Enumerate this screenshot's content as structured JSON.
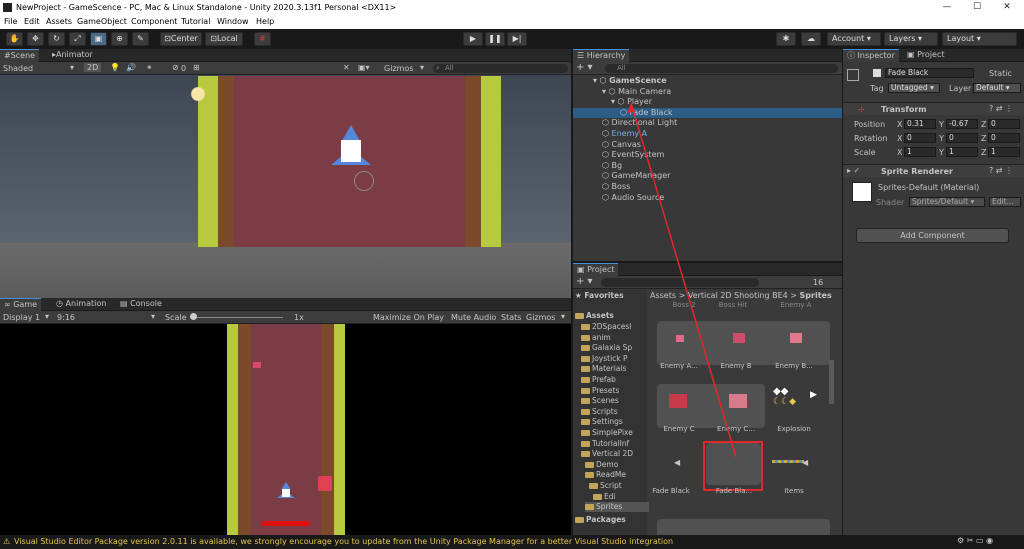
{
  "window": {
    "title": "NewProject - GameScence - PC, Mac & Linux Standalone - Unity 2020.3.13f1 Personal <DX11>"
  },
  "menu": [
    "File",
    "Edit",
    "Assets",
    "GameObject",
    "Component",
    "Tutorial",
    "Window",
    "Help"
  ],
  "toolbar": {
    "center": "Center",
    "local": "Local",
    "account": "Account",
    "layers": "Layers",
    "layout": "Layout"
  },
  "scene": {
    "tab_scene": "Scene",
    "tab_animator": "Animator",
    "shading": "Shaded",
    "mode2d": "2D",
    "gizmos": "Gizmos",
    "search": "All",
    "layer_count": "0"
  },
  "game": {
    "tab_game": "Game",
    "tab_animation": "Animation",
    "tab_console": "Console",
    "display": "Display 1",
    "aspect": "9:16",
    "scale_label": "Scale",
    "scale_value": "1x",
    "maximize": "Maximize On Play",
    "mute": "Mute Audio",
    "stats": "Stats",
    "gizmos": "Gizmos"
  },
  "hierarchy": {
    "tab": "Hierarchy",
    "search": "All",
    "rows": [
      {
        "label": "GameScence",
        "indent": 0,
        "bold": true
      },
      {
        "label": "Main Camera",
        "indent": 1
      },
      {
        "label": "Player",
        "indent": 2
      },
      {
        "label": "Fade Black",
        "indent": 3,
        "selected": true
      },
      {
        "label": "Directional Light",
        "indent": 1
      },
      {
        "label": "Enemy A",
        "indent": 1,
        "blue": true
      },
      {
        "label": "Canvas",
        "indent": 1
      },
      {
        "label": "EventSystem",
        "indent": 1
      },
      {
        "label": "Bg",
        "indent": 1
      },
      {
        "label": "GameManager",
        "indent": 1
      },
      {
        "label": "Boss",
        "indent": 1
      },
      {
        "label": "Audio Source",
        "indent": 1
      }
    ]
  },
  "project": {
    "tab": "Project",
    "count": "16",
    "favorites": "Favorites",
    "assets_root": "Assets",
    "packages": "Packages",
    "breadcrumb": [
      "Assets",
      "Vertical 2D Shooting BE4",
      "Sprites"
    ],
    "folders": [
      "2DSpacesl",
      "anim",
      "Galaxia Sp",
      "Joystick P",
      "Materials",
      "Prefab",
      "Presets",
      "Scenes",
      "Scripts",
      "Settings",
      "SimplePixe",
      "TutorialInf",
      "Vertical 2D",
      "Demo",
      "ReadMe",
      "Script",
      "Edi",
      "Sprites"
    ],
    "top_labels": [
      "Boss 2",
      "Boss Hit",
      "Enemy A"
    ],
    "items": [
      {
        "label": "Enemy A..."
      },
      {
        "label": "Enemy B"
      },
      {
        "label": "Enemy B..."
      },
      {
        "label": "Enemy C"
      },
      {
        "label": "Enemy C..."
      },
      {
        "label": "Explosion"
      },
      {
        "label": "Fade Black"
      },
      {
        "label": "Fade Bla..."
      },
      {
        "label": "Items"
      }
    ]
  },
  "inspector": {
    "tab_inspector": "Inspector",
    "tab_project": "Project",
    "object_name": "Fade Black",
    "static": "Static",
    "tag_label": "Tag",
    "tag_value": "Untagged",
    "layer_label": "Layer",
    "layer_value": "Default",
    "transform": {
      "title": "Transform",
      "position_label": "Position",
      "rotation_label": "Rotation",
      "scale_label": "Scale",
      "px": "0.31",
      "py": "-0.67",
      "pz": "0",
      "rx": "0",
      "ry": "0",
      "rz": "0",
      "sx": "1",
      "sy": "1",
      "sz": "1"
    },
    "sprite_renderer": {
      "title": "Sprite Renderer",
      "material": "Sprites-Default (Material)",
      "shader_label": "Shader",
      "shader_value": "Sprites/Default",
      "edit": "Edit..."
    },
    "add_component": "Add Component"
  },
  "status": {
    "message": "Visual Studio Editor Package version 2.0.11 is available, we strongly encourage you to update from the Unity Package Manager for a better Visual Studio integration"
  },
  "colors": {
    "accent": "#2c5d87",
    "selection": "#2c5d87",
    "warning": "#e4c64e",
    "arrow": "#e0282d"
  }
}
